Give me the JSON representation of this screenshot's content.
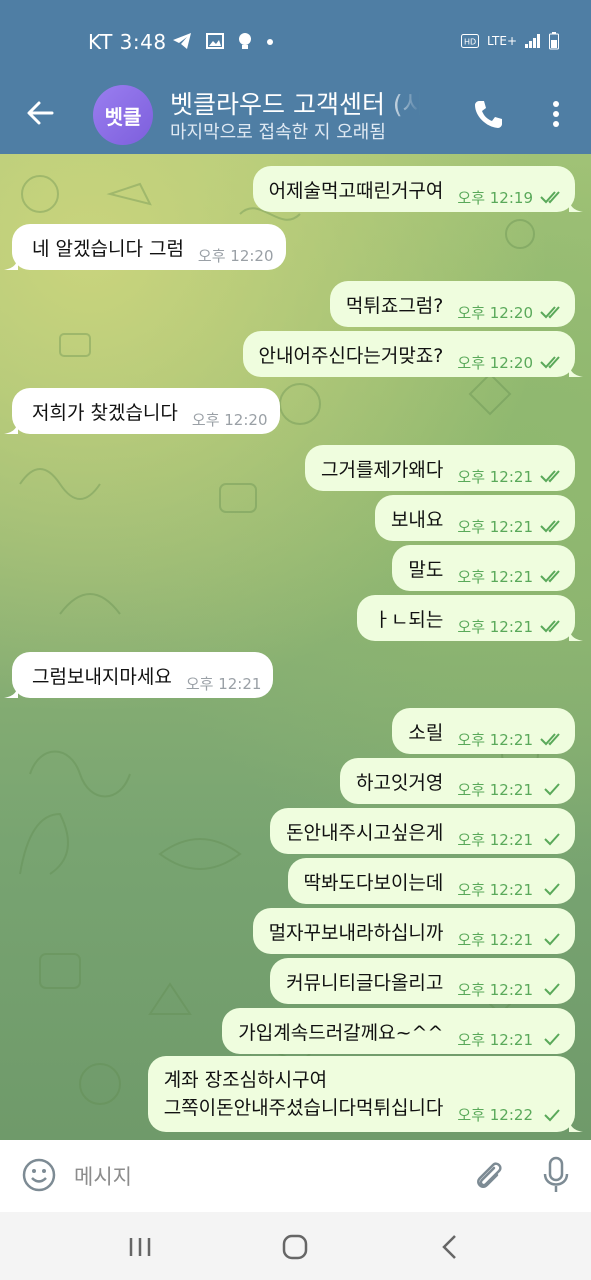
{
  "status_bar": {
    "carrier_time": "KT 3:48",
    "network": "LTE+"
  },
  "header": {
    "avatar_text": "벳클",
    "title": "벳클라우드 고객센터 (사",
    "subtitle": "마지막으로 접속한 지 오래됨"
  },
  "messages": [
    {
      "side": "out",
      "text": "어제술먹고때린거구여",
      "time": "오후 12:19",
      "ticks": "double"
    },
    {
      "side": "in",
      "text": "네 알겠습니다 그럼",
      "time": "오후 12:20"
    },
    {
      "side": "out",
      "text": "먹튀죠그럼?",
      "time": "오후 12:20",
      "ticks": "double"
    },
    {
      "side": "out",
      "text": "안내어주신다는거맞죠?",
      "time": "오후 12:20",
      "ticks": "double"
    },
    {
      "side": "in",
      "text": "저희가 찾겠습니다",
      "time": "오후 12:20"
    },
    {
      "side": "out",
      "text": "그거를제가왜다",
      "time": "오후 12:21",
      "ticks": "double"
    },
    {
      "side": "out",
      "text": "보내요",
      "time": "오후 12:21",
      "ticks": "double"
    },
    {
      "side": "out",
      "text": "말도",
      "time": "오후 12:21",
      "ticks": "double"
    },
    {
      "side": "out",
      "text": "ㅏㄴ되는",
      "time": "오후 12:21",
      "ticks": "double"
    },
    {
      "side": "in",
      "text": "그럼보내지마세요",
      "time": "오후 12:21"
    },
    {
      "side": "out",
      "text": "소릴",
      "time": "오후 12:21",
      "ticks": "double"
    },
    {
      "side": "out",
      "text": "하고잇거영",
      "time": "오후 12:21",
      "ticks": "single"
    },
    {
      "side": "out",
      "text": "돈안내주시고싶은게",
      "time": "오후 12:21",
      "ticks": "single"
    },
    {
      "side": "out",
      "text": "딱봐도다보이는데",
      "time": "오후 12:21",
      "ticks": "single"
    },
    {
      "side": "out",
      "text": "멀자꾸보내라하십니까",
      "time": "오후 12:21",
      "ticks": "single"
    },
    {
      "side": "out",
      "text": "커뮤니티글다올리고",
      "time": "오후 12:21",
      "ticks": "single"
    },
    {
      "side": "out",
      "text": "가입계속드러갈께요~^^",
      "time": "오후 12:21",
      "ticks": "single"
    },
    {
      "side": "out",
      "text": "계좌 장조심하시구여",
      "text2": "그쪽이돈안내주셨습니다먹튀십니다",
      "time": "오후 12:22",
      "ticks": "single"
    }
  ],
  "input": {
    "placeholder": "메시지"
  },
  "colors": {
    "header": "#4f7ea4",
    "out_bubble": "#effdde",
    "in_bubble": "#ffffff",
    "tick": "#5aa95a"
  }
}
